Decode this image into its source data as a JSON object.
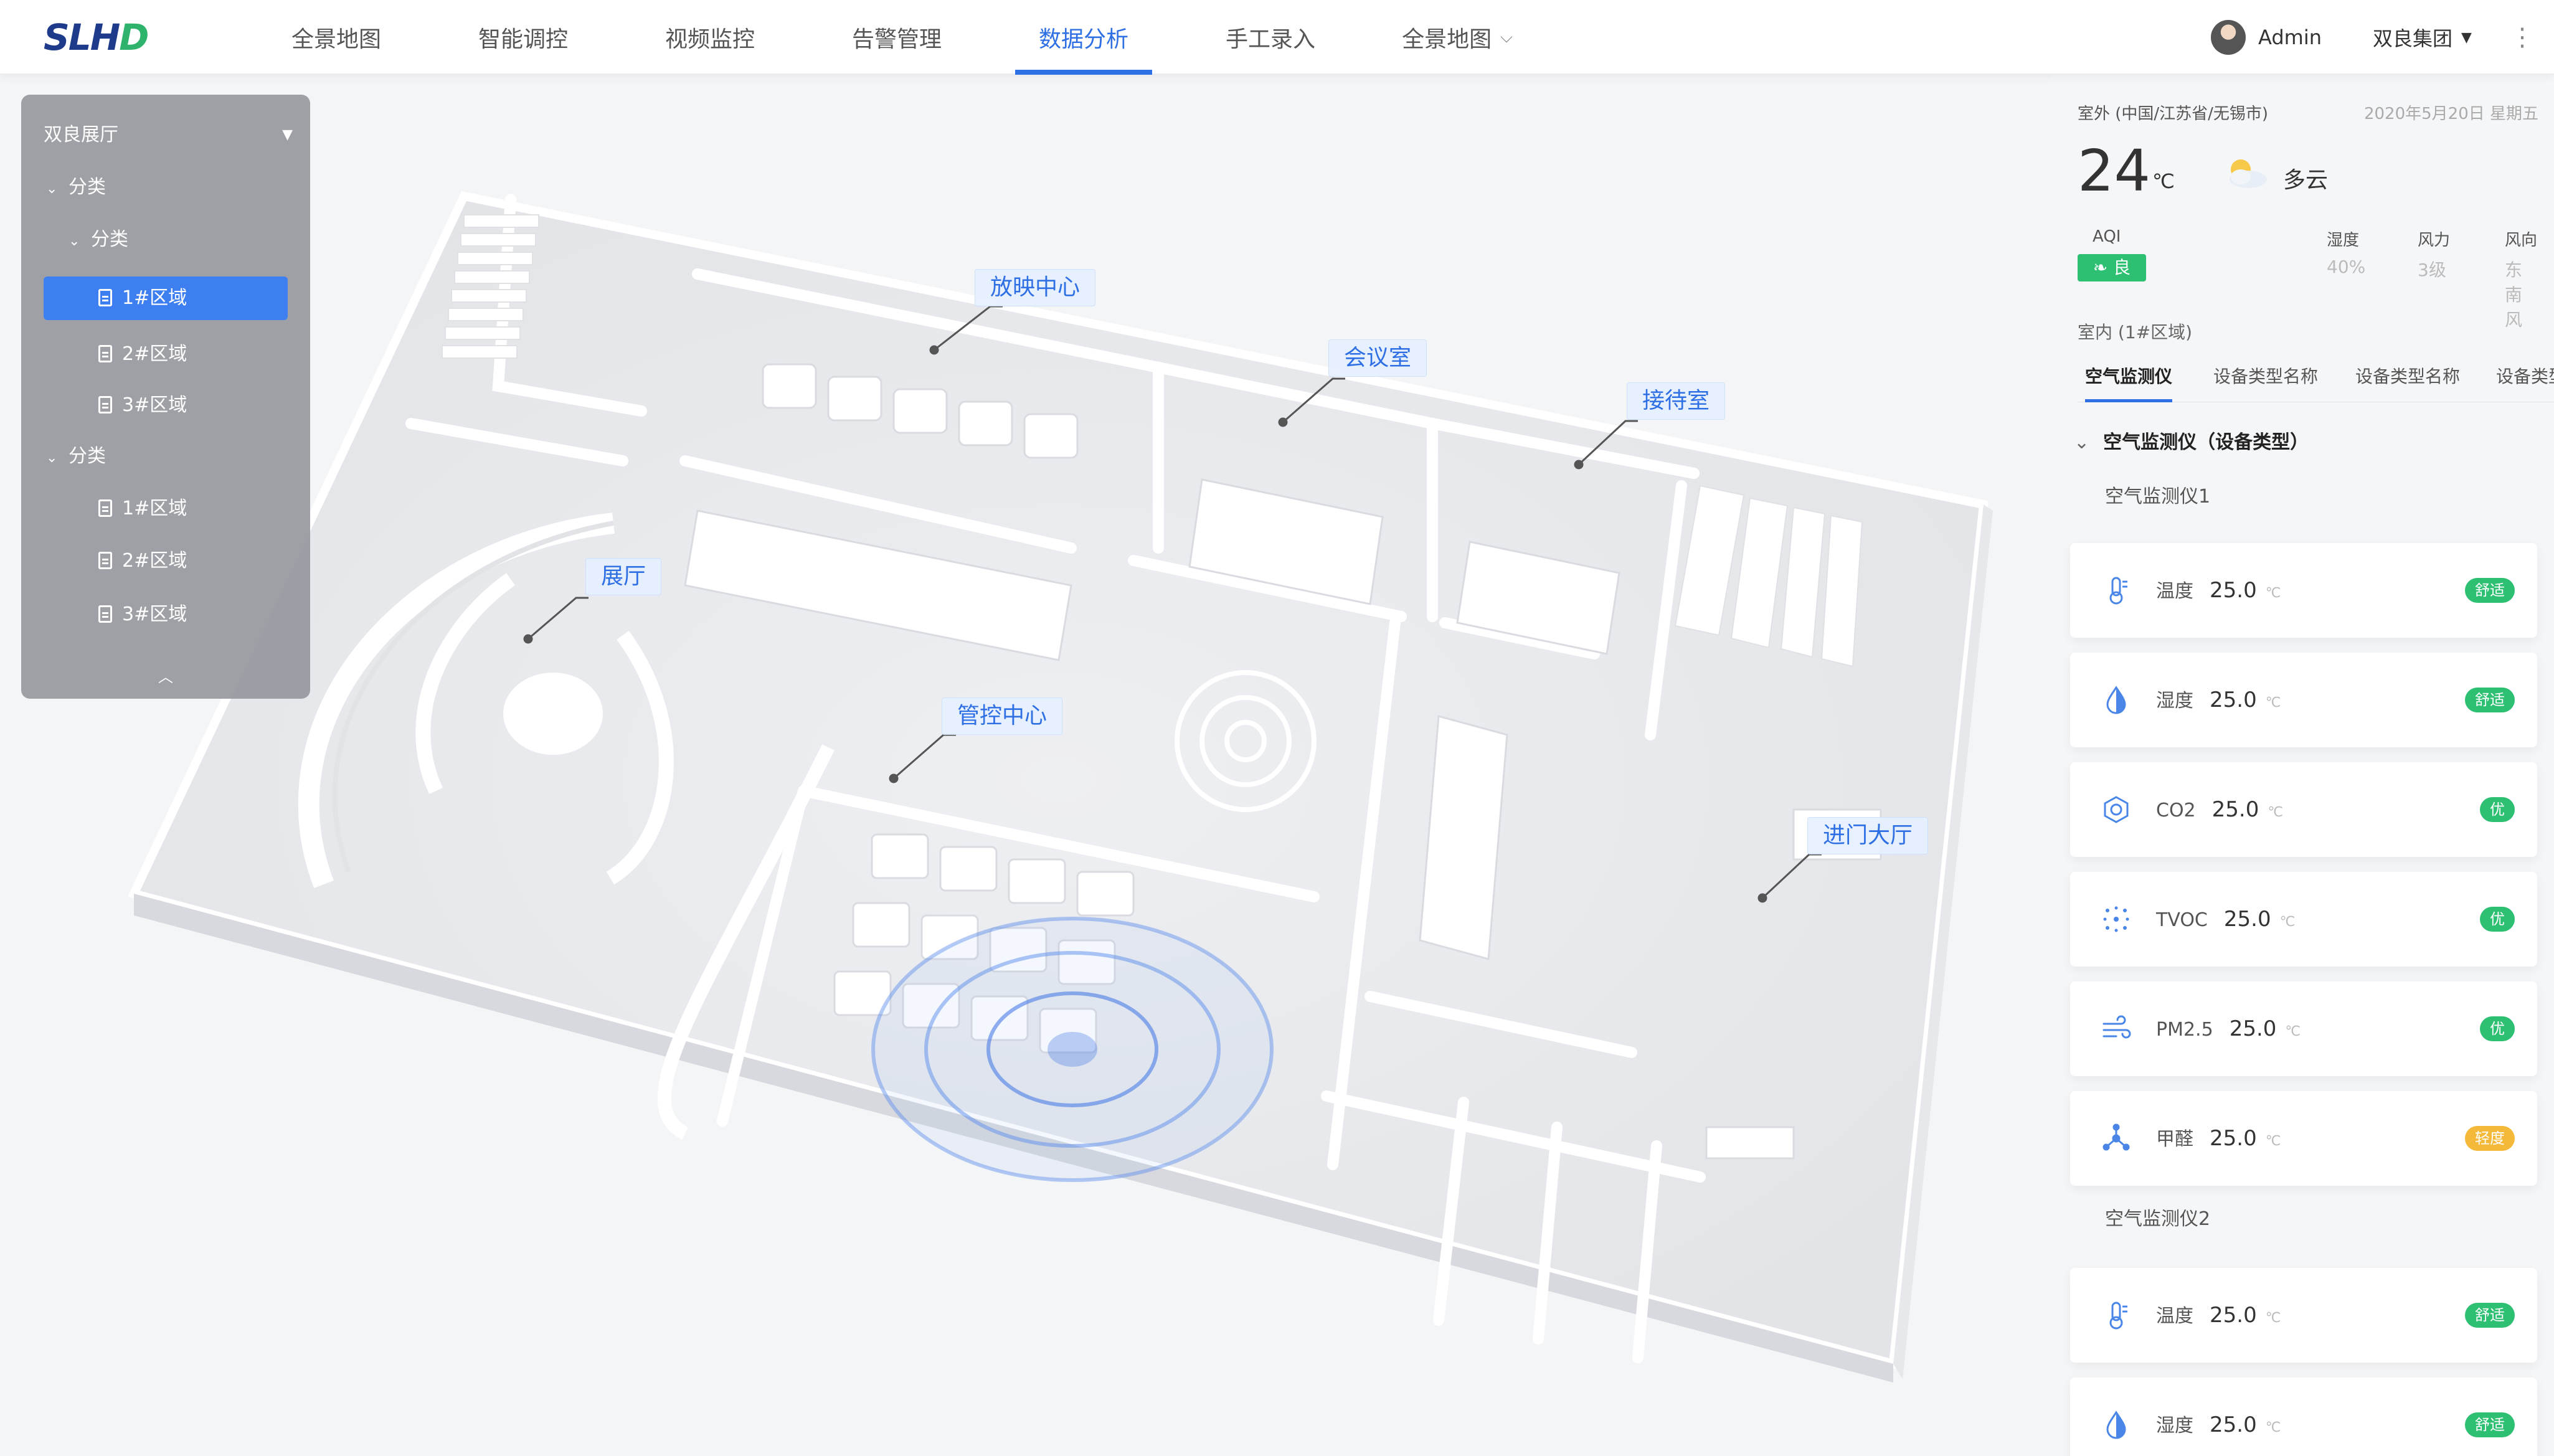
{
  "brand": {
    "logo_text_a": "SLH",
    "logo_text_b": "D"
  },
  "nav": {
    "items": [
      {
        "label": "全景地图"
      },
      {
        "label": "智能调控"
      },
      {
        "label": "视频监控"
      },
      {
        "label": "告警管理"
      },
      {
        "label": "数据分析",
        "active": true
      },
      {
        "label": "手工录入"
      },
      {
        "label": "全景地图",
        "has_dropdown": true
      }
    ]
  },
  "user": {
    "name": "Admin",
    "org": "双良集团"
  },
  "tree": {
    "title": "双良展厅",
    "rows": [
      {
        "label": "分类",
        "level": 0,
        "type": "folder"
      },
      {
        "label": "分类",
        "level": 1,
        "type": "folder"
      },
      {
        "label": "1#区域",
        "level": 2,
        "type": "file",
        "selected": true
      },
      {
        "label": "2#区域",
        "level": 2,
        "type": "file"
      },
      {
        "label": "3#区域",
        "level": 2,
        "type": "file"
      },
      {
        "label": "分类",
        "level": 0,
        "type": "folder"
      },
      {
        "label": "1#区域",
        "level": 2,
        "type": "file"
      },
      {
        "label": "2#区域",
        "level": 2,
        "type": "file"
      },
      {
        "label": "3#区域",
        "level": 2,
        "type": "file"
      }
    ]
  },
  "map": {
    "labels": [
      {
        "text": "放映中心"
      },
      {
        "text": "会议室"
      },
      {
        "text": "接待室"
      },
      {
        "text": "展厅"
      },
      {
        "text": "管控中心"
      },
      {
        "text": "进门大厅"
      }
    ]
  },
  "weather": {
    "location": "室外 (中国/江苏省/无锡市)",
    "date": "2020年5月20日  星期五",
    "temp": "24",
    "unit": "℃",
    "desc": "多云",
    "aqi_label": "AQI",
    "aqi_value": "良",
    "stats": [
      {
        "label": "湿度",
        "value": "40%"
      },
      {
        "label": "风力",
        "value": "3级"
      },
      {
        "label": "风向",
        "value": "东南风"
      }
    ]
  },
  "indoor": {
    "title": "室内 (1#区域)",
    "tabs": [
      {
        "label": "空气监测仪",
        "active": true
      },
      {
        "label": "设备类型名称"
      },
      {
        "label": "设备类型名称"
      },
      {
        "label": "设备类型"
      }
    ],
    "group_title": "空气监测仪（设备类型）",
    "devices": [
      {
        "name": "空气监测仪1",
        "readings": [
          {
            "icon": "thermometer-icon",
            "label": "温度",
            "value": "25.0",
            "unit": "℃",
            "status": "舒适",
            "status_color": "#2dbf72"
          },
          {
            "icon": "water-drop-icon",
            "label": "湿度",
            "value": "25.0",
            "unit": "℃",
            "status": "舒适",
            "status_color": "#2dbf72"
          },
          {
            "icon": "co2-icon",
            "label": "CO2",
            "value": "25.0",
            "unit": "℃",
            "status": "优",
            "status_color": "#2dbf72"
          },
          {
            "icon": "tvoc-icon",
            "label": "TVOC",
            "value": "25.0",
            "unit": "℃",
            "status": "优",
            "status_color": "#2dbf72"
          },
          {
            "icon": "wind-icon",
            "label": "PM2.5",
            "value": "25.0",
            "unit": "℃",
            "status": "优",
            "status_color": "#2dbf72"
          },
          {
            "icon": "molecule-icon",
            "label": "甲醛",
            "value": "25.0",
            "unit": "℃",
            "status": "轻度",
            "status_color": "#f5b93a"
          }
        ]
      },
      {
        "name": "空气监测仪2",
        "readings": [
          {
            "icon": "thermometer-icon",
            "label": "温度",
            "value": "25.0",
            "unit": "℃",
            "status": "舒适",
            "status_color": "#2dbf72"
          },
          {
            "icon": "water-drop-icon",
            "label": "湿度",
            "value": "25.0",
            "unit": "℃",
            "status": "舒适",
            "status_color": "#2dbf72"
          }
        ]
      }
    ]
  },
  "colors": {
    "accent": "#2f6fe4",
    "good": "#2dbf72",
    "warn": "#f5b93a"
  }
}
